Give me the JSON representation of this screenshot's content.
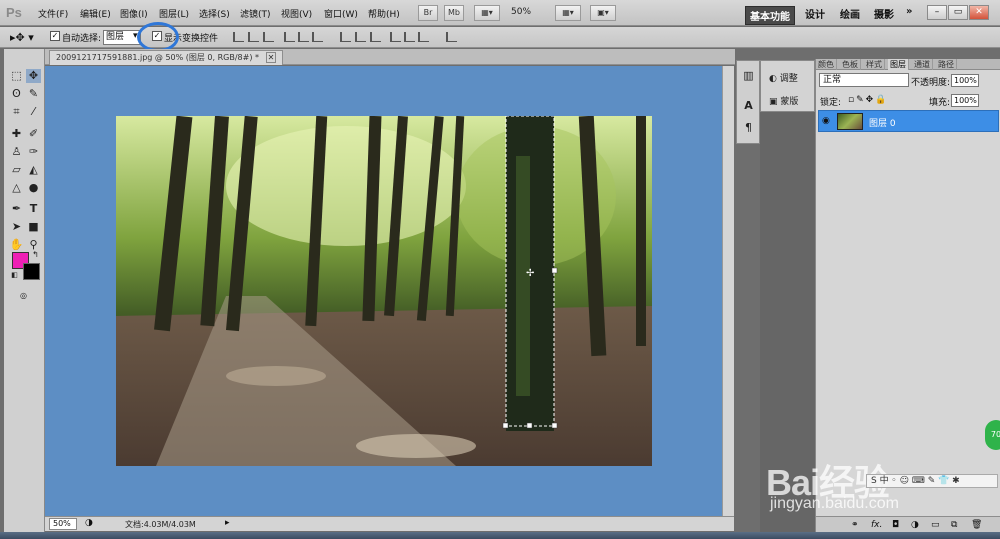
{
  "app": {
    "logo": "Ps"
  },
  "menu": [
    "文件(F)",
    "编辑(E)",
    "图像(I)",
    "图层(L)",
    "选择(S)",
    "滤镜(T)",
    "视图(V)",
    "窗口(W)",
    "帮助(H)"
  ],
  "menubar": {
    "br_label": "Br",
    "mb_label": "Mb",
    "zoom": "50%"
  },
  "workspaces": {
    "active": "基本功能",
    "items": [
      "设计",
      "绘画",
      "摄影"
    ],
    "more": "»"
  },
  "window_controls": {
    "minimize": "–",
    "restore": "▭",
    "close": "✕"
  },
  "options": {
    "auto_select_label": "自动选择:",
    "auto_select_value": "图层",
    "show_transform_label": "显示变换控件"
  },
  "document": {
    "tab_title": "20091217175918​81.jpg @ 50% (图层 0, RGB/8#) *",
    "status_zoom": "50%",
    "status_info": "文档:4.03M/4.03M"
  },
  "adjust_panel": {
    "adjust": "调整",
    "mask": "蒙版"
  },
  "layers_panel": {
    "tabs": [
      "颜色",
      "色板",
      "样式",
      "图层",
      "通道",
      "路径"
    ],
    "active_tab": "图层",
    "blend_mode": "正常",
    "opacity_label": "不透明度:",
    "opacity_value": "100%",
    "lock_label": "锁定:",
    "fill_label": "填充:",
    "fill_value": "100%",
    "layers": [
      {
        "name": "图层 0",
        "visible": true
      }
    ],
    "footer_icons": [
      "link-icon",
      "fx-icon",
      "mask-icon",
      "adjustment-icon",
      "group-icon",
      "new-layer-icon",
      "delete-icon"
    ]
  },
  "watermark": {
    "brand": "Bai经验",
    "url": "jingyan.baidu.com"
  },
  "colors": {
    "foreground": "#ee1fb5",
    "background": "#000000",
    "canvas_bg": "#5d8ec4",
    "selection": "#3d8ee6"
  }
}
